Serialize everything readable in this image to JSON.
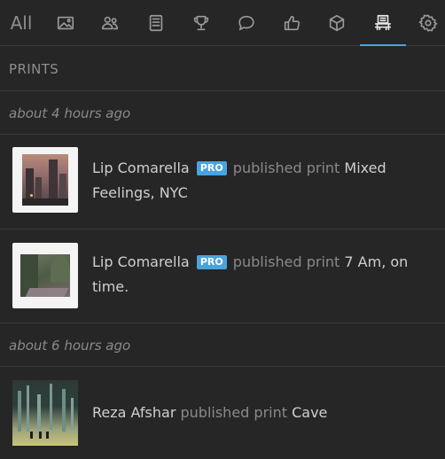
{
  "tabs": [
    {
      "label": "All",
      "icon": "all"
    },
    {
      "icon": "image-icon"
    },
    {
      "icon": "users-icon"
    },
    {
      "icon": "book-icon"
    },
    {
      "icon": "trophy-icon"
    },
    {
      "icon": "comment-icon"
    },
    {
      "icon": "thumbs-up-icon"
    },
    {
      "icon": "box-icon"
    },
    {
      "icon": "print-icon",
      "active": true
    },
    {
      "icon": "gear-icon"
    }
  ],
  "section_title": "PRINTS",
  "groups": [
    {
      "time": "about 4 hours ago"
    },
    {
      "time": "about 6 hours ago"
    }
  ],
  "items": [
    {
      "user": "Lip Comarella",
      "badge": "PRO",
      "action": "published print",
      "title": "Mixed Feelings, NYC"
    },
    {
      "user": "Lip Comarella",
      "badge": "PRO",
      "action": "published print",
      "title": "7 Am, on time."
    },
    {
      "user": "Reza Afshar",
      "action": "published print",
      "title": "Cave"
    }
  ],
  "colors": {
    "accent": "#4aa3df",
    "background": "#262626",
    "divider": "#3a3a3a"
  }
}
